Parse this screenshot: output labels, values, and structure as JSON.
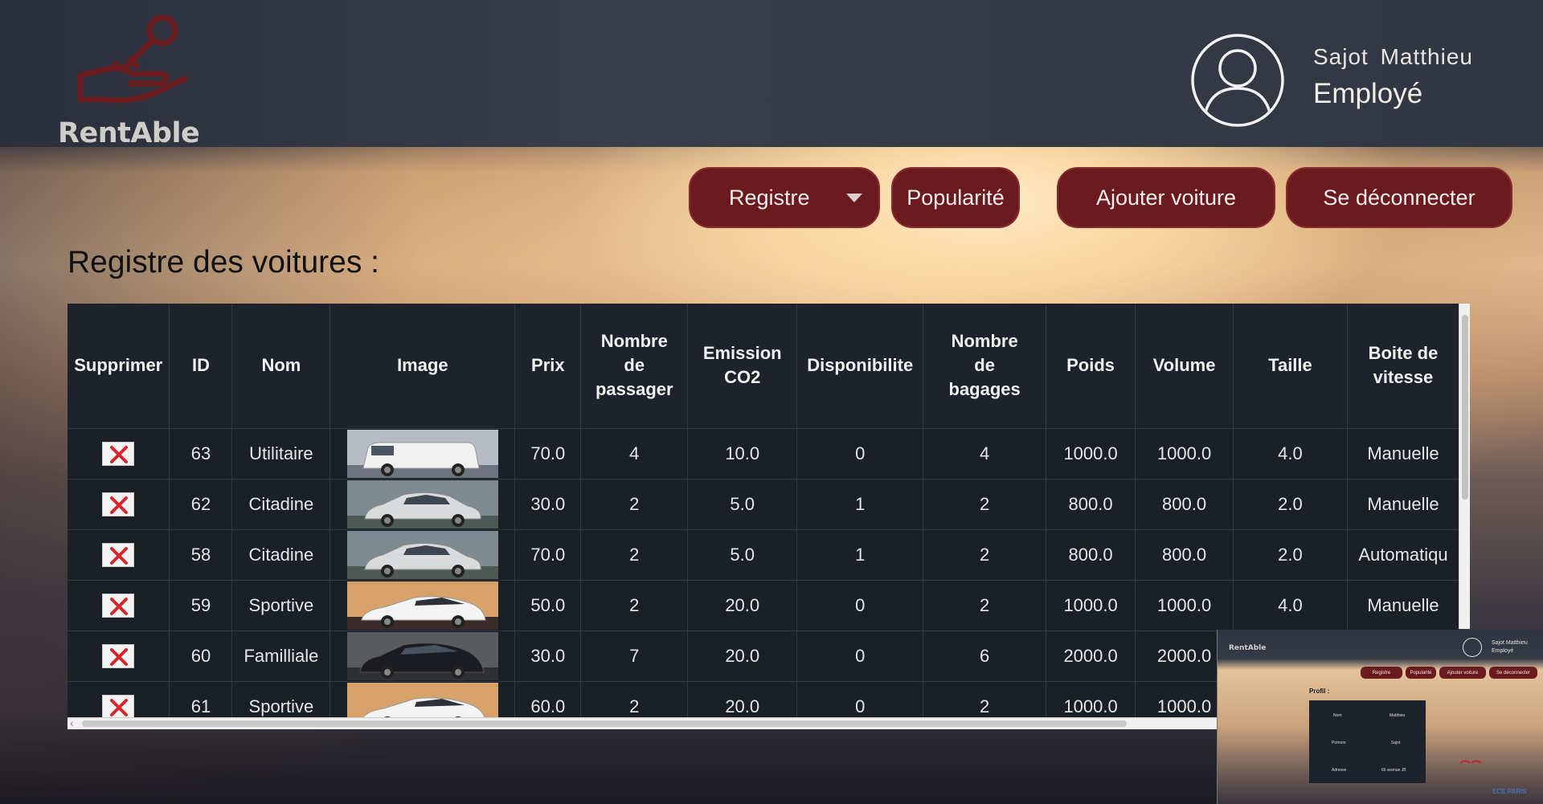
{
  "app": {
    "logo_text": "RentAble",
    "accent_color": "#6b1a1e"
  },
  "user": {
    "name": "Sajot  Matthieu",
    "role": "Employé",
    "avatar_icon": "user-circle-icon"
  },
  "nav": {
    "registre": "Registre",
    "popularite": "Popularité",
    "ajouter": "Ajouter voiture",
    "deconnecter": "Se déconnecter"
  },
  "page": {
    "title": "Registre des voitures :"
  },
  "table": {
    "headers": {
      "supprimer": "Supprimer",
      "id": "ID",
      "nom": "Nom",
      "image": "Image",
      "prix": "Prix",
      "passagers_1": "Nombre",
      "passagers_2": "de",
      "passagers_3": "passager",
      "co2_1": "Emission",
      "co2_2": "CO2",
      "dispo": "Disponibilite",
      "bagages_1": "Nombre",
      "bagages_2": "de",
      "bagages_3": "bagages",
      "poids": "Poids",
      "volume": "Volume",
      "taille": "Taille",
      "boite_1": "Boite de",
      "boite_2": "vitesse"
    },
    "rows": [
      {
        "id": "63",
        "nom": "Utilitaire",
        "image": "white-van",
        "prix": "70.0",
        "passagers": "4",
        "co2": "10.0",
        "dispo": "0",
        "bagages": "4",
        "poids": "1000.0",
        "volume": "1000.0",
        "taille": "4.0",
        "boite": "Manuelle"
      },
      {
        "id": "62",
        "nom": "Citadine",
        "image": "silver-hatchback",
        "prix": "30.0",
        "passagers": "2",
        "co2": "5.0",
        "dispo": "1",
        "bagages": "2",
        "poids": "800.0",
        "volume": "800.0",
        "taille": "2.0",
        "boite": "Manuelle"
      },
      {
        "id": "58",
        "nom": "Citadine",
        "image": "silver-hatchback",
        "prix": "70.0",
        "passagers": "2",
        "co2": "5.0",
        "dispo": "1",
        "bagages": "2",
        "poids": "800.0",
        "volume": "800.0",
        "taille": "2.0",
        "boite": "Automatiqu"
      },
      {
        "id": "59",
        "nom": "Sportive",
        "image": "white-sports-suv",
        "prix": "50.0",
        "passagers": "2",
        "co2": "20.0",
        "dispo": "0",
        "bagages": "2",
        "poids": "1000.0",
        "volume": "1000.0",
        "taille": "4.0",
        "boite": "Manuelle"
      },
      {
        "id": "60",
        "nom": "Familliale",
        "image": "black-minivan",
        "prix": "30.0",
        "passagers": "7",
        "co2": "20.0",
        "dispo": "0",
        "bagages": "6",
        "poids": "2000.0",
        "volume": "2000.0",
        "taille": "",
        "boite": ""
      },
      {
        "id": "61",
        "nom": "Sportive",
        "image": "white-sports-suv",
        "prix": "60.0",
        "passagers": "2",
        "co2": "20.0",
        "dispo": "0",
        "bagages": "2",
        "poids": "1000.0",
        "volume": "1000.0",
        "taille": "",
        "boite": ""
      }
    ]
  },
  "preview": {
    "logo_text": "RentAble",
    "user_name": "Sajot  Matthieu",
    "user_role": "Employé",
    "buttons": [
      "Registre",
      "Popularité",
      "Ajouter voiture",
      "Se déconnecter"
    ],
    "title": "Profil :",
    "cells": [
      "Nom",
      "Matthieu",
      "Prénom",
      "Sajot",
      "Adresse",
      "66 avenue JB"
    ],
    "footer": "ECE PARIS"
  }
}
